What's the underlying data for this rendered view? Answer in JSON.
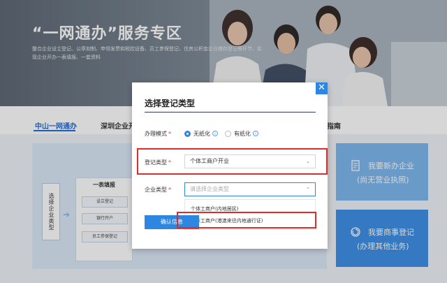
{
  "hero": {
    "title": "“一网通办”服务专区",
    "subtitle": "整合企业设立登记、公章刻制、申领发票和税控设备、员工参保登记、住房公积金企业缴存登记等环节，实现企业开办一表填报、一套资料"
  },
  "tabs": {
    "items": [
      {
        "label": "中山一网通办"
      },
      {
        "label": "深圳企业开"
      },
      {
        "label": "指南"
      }
    ]
  },
  "flow": {
    "side_label": "选择企业类型",
    "block_title": "一表填报",
    "items": [
      "设立登记",
      "银行开户",
      "员工参保登记"
    ]
  },
  "cards": [
    {
      "line1": "我要新办企业",
      "line2": "(尚无营业执照)",
      "icon": "document-icon"
    },
    {
      "line1": "我要商事登记",
      "line2": "(办理其他业务)",
      "icon": "refresh-icon"
    }
  ],
  "modal": {
    "title": "选择登记类型",
    "close_icon": "close-icon",
    "mode_label": "办理模式",
    "mode_options": [
      {
        "label": "无纸化",
        "selected": true
      },
      {
        "label": "有纸化",
        "selected": false
      }
    ],
    "reg_type_label": "登记类型",
    "reg_type_value": "个体工商户开业",
    "ent_type_label": "企业类型",
    "ent_type_placeholder": "请选择企业类型",
    "ent_type_options": [
      "个体工商户(内地居民)",
      "个体工商户(港澳来往内地通行证)"
    ],
    "confirm_label": "确认信息"
  },
  "colors": {
    "accent": "#2f86e0",
    "highlight": "#e02b2b",
    "card_blue": "#3a8ee6"
  }
}
